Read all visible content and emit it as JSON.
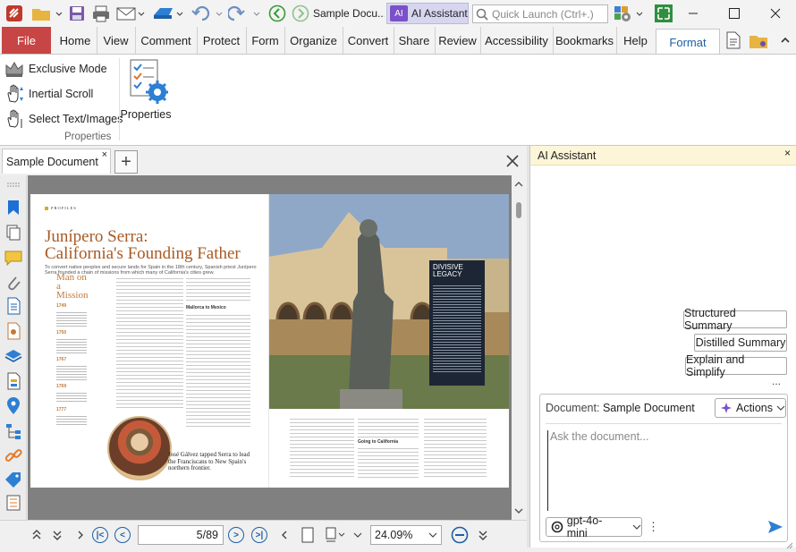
{
  "qat": {
    "doc_pill": "Sample Docu...",
    "ai_button": "AI Assistant",
    "ai_badge": "AI",
    "quick_launch_placeholder": "Quick Launch (Ctrl+.)"
  },
  "ribbon_tabs": [
    {
      "label": "File"
    },
    {
      "label": "Home"
    },
    {
      "label": "View"
    },
    {
      "label": "Comment"
    },
    {
      "label": "Protect"
    },
    {
      "label": "Form"
    },
    {
      "label": "Organize"
    },
    {
      "label": "Convert"
    },
    {
      "label": "Share"
    },
    {
      "label": "Review"
    },
    {
      "label": "Accessibility"
    },
    {
      "label": "Bookmarks"
    },
    {
      "label": "Help"
    },
    {
      "label": "Format"
    }
  ],
  "ribbon": {
    "exclusive_mode": "Exclusive Mode",
    "inertial_scroll": "Inertial Scroll",
    "select_text_images": "Select Text/Images",
    "properties": "Properties",
    "group_label": "Properties"
  },
  "document_tab": {
    "title": "Sample Document",
    "close": "×",
    "add": "+"
  },
  "page": {
    "section": "PROFILES",
    "title_line1": "Junípero Serra:",
    "title_line2": "California's Founding Father",
    "subtitle": "To convert native peoples and secure lands for Spain in the 18th century, Spanish priest Junípero Serra founded a chain of missions from which many of California's cities grew.",
    "sidebar_title": "Man on a Mission",
    "years": [
      "1749",
      "1750",
      "1767",
      "1769",
      "1777"
    ],
    "caption": "José Gálvez tapped Serra to lead the Franciscans to New Spain's northern frontier.",
    "callout_title": "DIVISIVE LEGACY",
    "subhead_left": "Mallorca to Mexico",
    "subhead_right": "Going to California"
  },
  "status_bar": {
    "page_value": "5",
    "page_total": "/89",
    "zoom": "24.09%"
  },
  "ai_panel": {
    "title": "AI Assistant",
    "close": "×",
    "chips": [
      "Structured Summary",
      "Distilled Summary",
      "Explain and Simplify"
    ],
    "more": "...",
    "document_label": "Document:",
    "document_name": "Sample Document",
    "actions_label": "Actions",
    "ask_placeholder": "Ask the document...",
    "model": "gpt-4o-mini"
  },
  "colors": {
    "file_tab": "#c74545",
    "accent_blue": "#1d5fa6",
    "ai_panel_header": "#fdf5d8",
    "page_orange": "#c1783a",
    "callout_bg": "#1c2635"
  }
}
